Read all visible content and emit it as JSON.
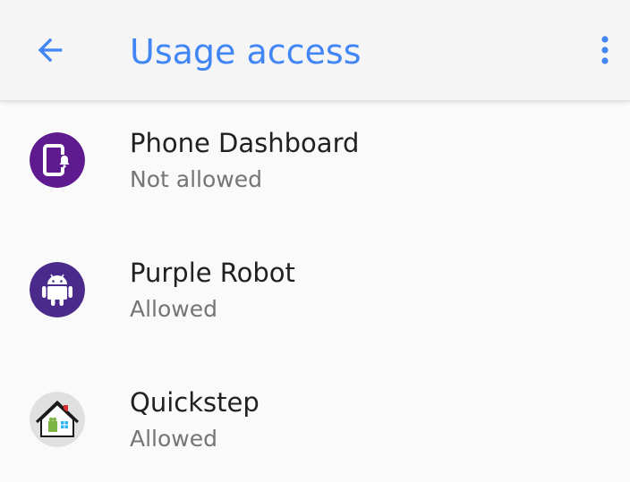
{
  "toolbar": {
    "back_icon": "arrow-back-icon",
    "title": "Usage access",
    "overflow_icon": "more-vert-icon"
  },
  "apps": [
    {
      "name": "Phone Dashboard",
      "status": "Not allowed",
      "icon": "phone-dashboard-icon",
      "icon_color": "#5e1a8e"
    },
    {
      "name": "Purple Robot",
      "status": "Allowed",
      "icon": "android-robot-icon",
      "icon_color": "#4a2a8a"
    },
    {
      "name": "Quickstep",
      "status": "Allowed",
      "icon": "home-launcher-icon",
      "icon_color": "#e0e0e0"
    }
  ],
  "colors": {
    "accent": "#4285f4",
    "primary_text": "#212121",
    "secondary_text": "#757575",
    "background": "#fafafa"
  }
}
